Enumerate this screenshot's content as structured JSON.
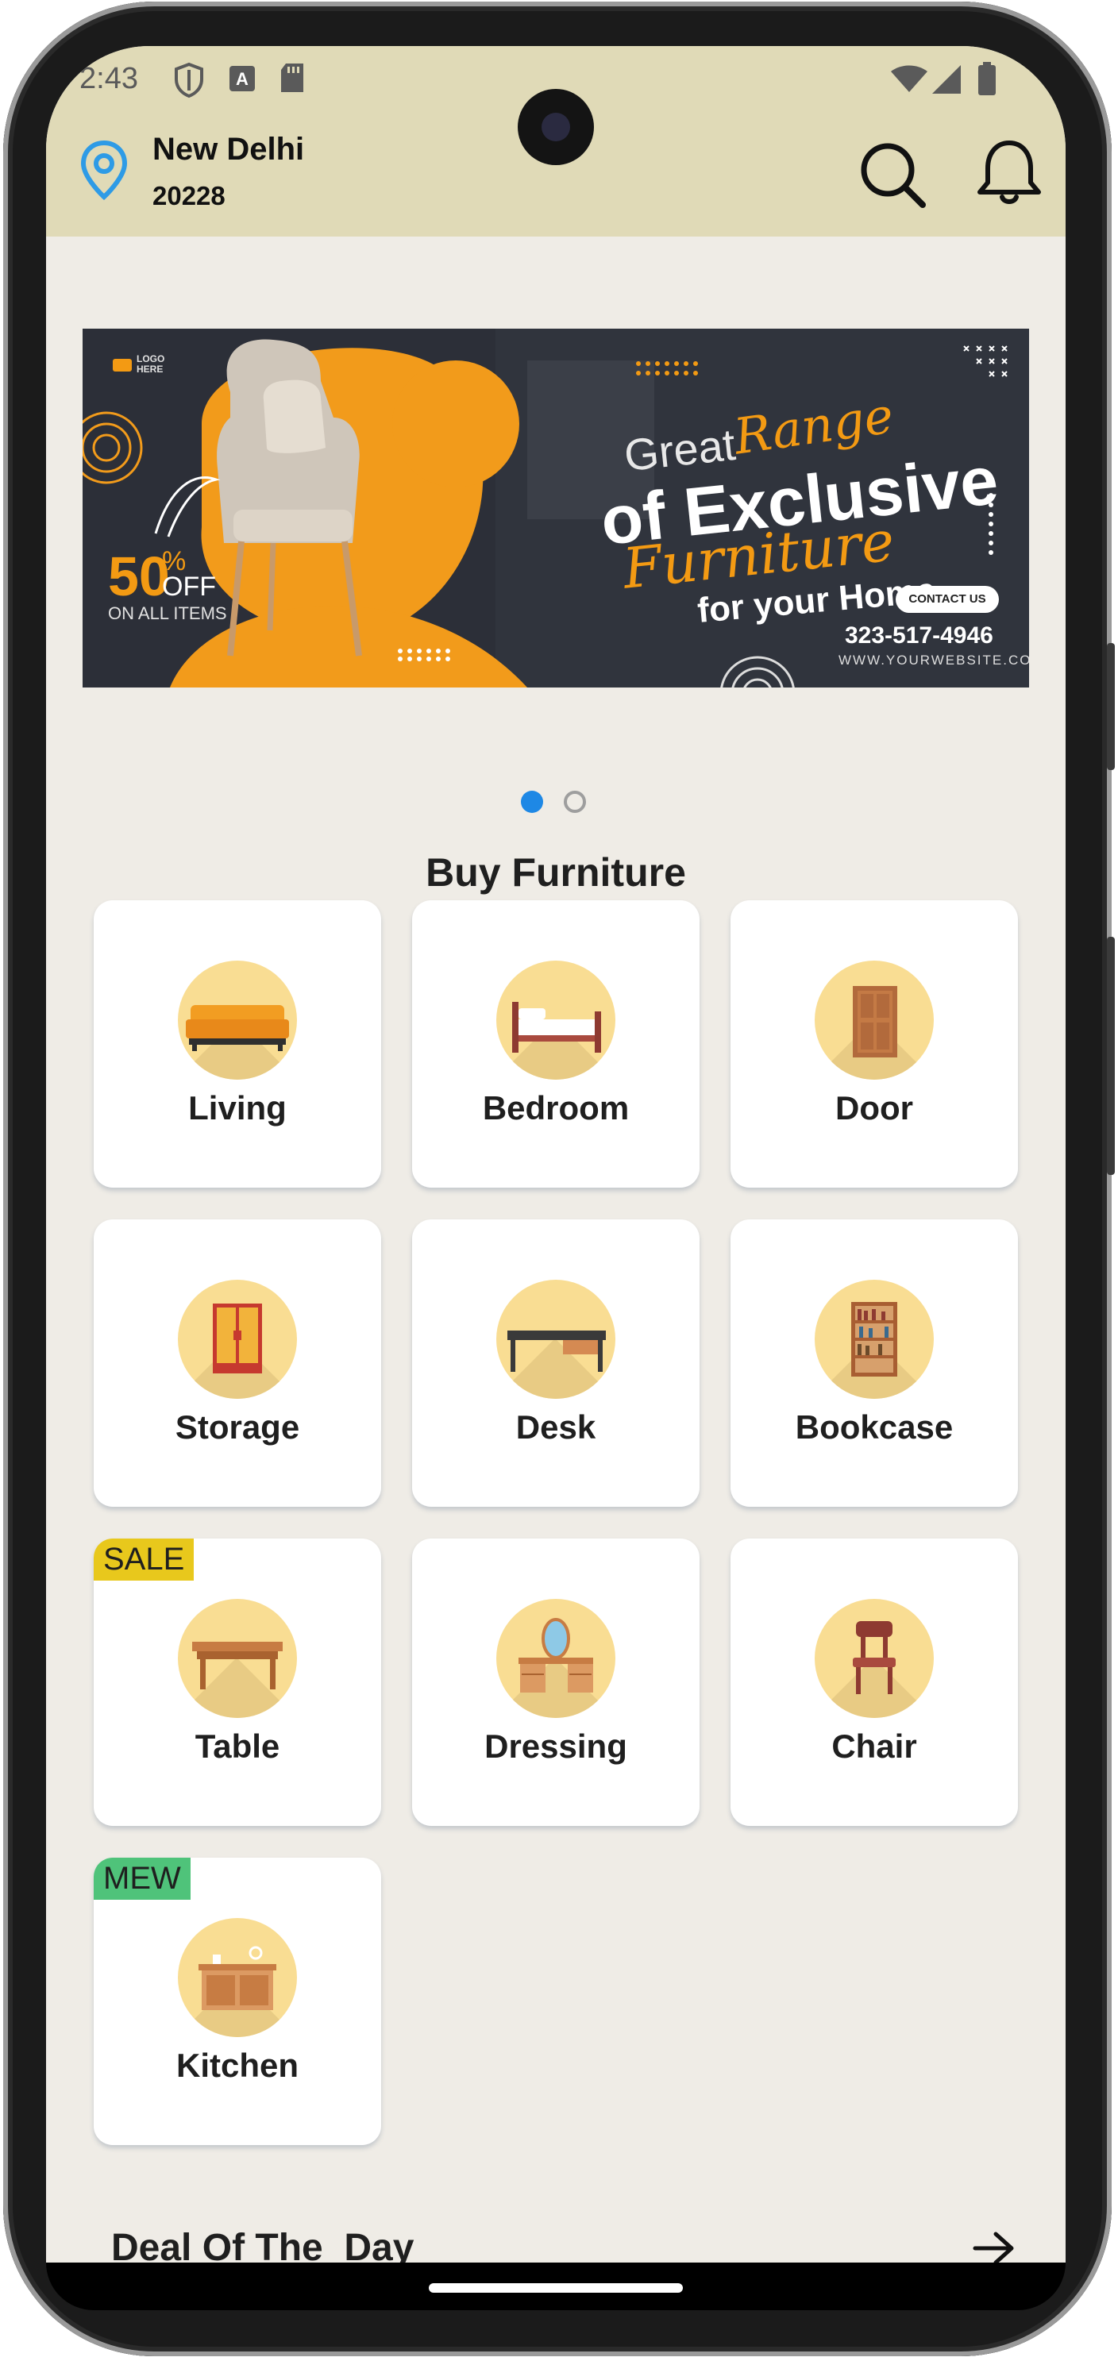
{
  "status_bar": {
    "time": "2:43"
  },
  "header": {
    "city": "New Delhi",
    "pincode": "20228"
  },
  "banner": {
    "logo_text": "LOGO HERE",
    "line_great": "Great",
    "line_range": "Range",
    "line_exclusive": "of Exclusive",
    "line_furniture": "Furniture",
    "line_home": "for your Home",
    "contact_button": "CONTACT US",
    "phone": "323-517-4946",
    "website": "WWW.YOURWEBSITE.COM",
    "discount_value": "50",
    "discount_percent": "%",
    "discount_off": "OFF",
    "discount_scope": "ON ALL ITEMS",
    "carousel_index": 1,
    "carousel_count": 2
  },
  "section_title": "Buy Furniture",
  "categories": [
    {
      "label": "Living",
      "icon": "sofa-icon"
    },
    {
      "label": "Bedroom",
      "icon": "bed-icon"
    },
    {
      "label": "Door",
      "icon": "door-icon"
    },
    {
      "label": "Storage",
      "icon": "wardrobe-icon"
    },
    {
      "label": "Desk",
      "icon": "desk-icon"
    },
    {
      "label": "Bookcase",
      "icon": "bookcase-icon"
    },
    {
      "label": "Table",
      "icon": "table-icon",
      "tag": "SALE"
    },
    {
      "label": "Dressing",
      "icon": "dressing-table-icon"
    },
    {
      "label": "Chair",
      "icon": "chair-icon"
    },
    {
      "label": "Kitchen",
      "icon": "kitchen-icon",
      "tag": "MEW"
    }
  ],
  "deal_section": {
    "title": "Deal Of The  Day"
  },
  "colors": {
    "header_bg": "#e0dab7",
    "screen_bg": "#efece6",
    "accent_blue": "#1e88e5",
    "icon_circle": "#f9dd93",
    "sale_tag": "#e8c81c",
    "new_tag": "#4fc37a",
    "banner_orange": "#f39a13"
  }
}
